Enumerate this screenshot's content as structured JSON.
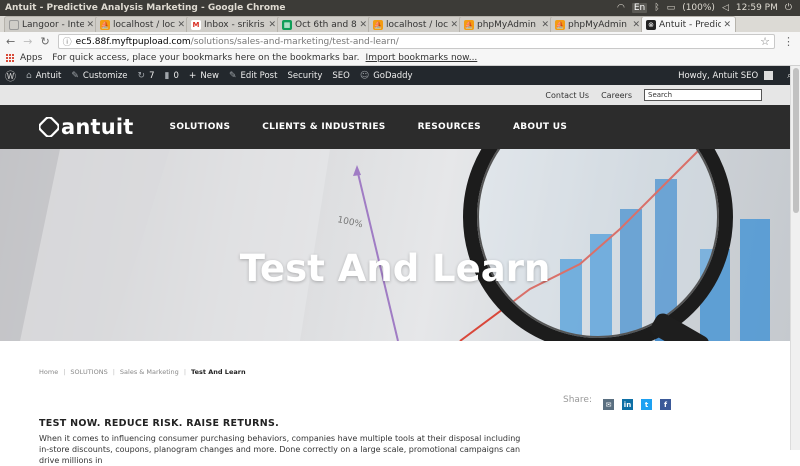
{
  "os": {
    "window_title": "Antuit - Predictive Analysis Marketing - Google Chrome",
    "kbd": "En",
    "battery": "(100%)",
    "time": "12:59 PM"
  },
  "tabs": [
    {
      "label": "Langoor - Inte",
      "fav_color": "#ffffff",
      "fav_char": ""
    },
    {
      "label": "localhost / loc",
      "fav_color": "#f39c12",
      "fav_char": "⛵"
    },
    {
      "label": "Inbox - srikris",
      "fav_color": "#d93025",
      "fav_char": "M"
    },
    {
      "label": "Oct 6th and 8t",
      "fav_color": "#0f9d58",
      "fav_char": "▦"
    },
    {
      "label": "localhost / loc",
      "fav_color": "#f39c12",
      "fav_char": "⛵"
    },
    {
      "label": "phpMyAdmin",
      "fav_color": "#f39c12",
      "fav_char": "⛵"
    },
    {
      "label": "phpMyAdmin",
      "fav_color": "#f39c12",
      "fav_char": "⛵"
    },
    {
      "label": "Antuit - Predic",
      "fav_color": "#222222",
      "fav_char": "⊗",
      "active": true
    }
  ],
  "address": {
    "host": "ec5.88f.myftpupload.com",
    "path": "/solutions/sales-and-marketing/test-and-learn/"
  },
  "bookmarks": {
    "apps": "Apps",
    "hint": "For quick access, place your bookmarks here on the bookmarks bar.",
    "import": "Import bookmarks now..."
  },
  "wpbar": {
    "site": "Antuit",
    "customize": "Customize",
    "updates": "7",
    "comments": "0",
    "new": "New",
    "edit": "Edit Post",
    "security": "Security",
    "seo": "SEO",
    "godaddy": "GoDaddy",
    "howdy": "Howdy, Antuit SEO"
  },
  "util": {
    "contact": "Contact Us",
    "careers": "Careers",
    "search_placeholder": "Search"
  },
  "header": {
    "logo": "antuit",
    "nav": [
      "SOLUTIONS",
      "CLIENTS & INDUSTRIES",
      "RESOURCES",
      "ABOUT US"
    ]
  },
  "hero": {
    "title": "Test And Learn",
    "image_label": "100%"
  },
  "breadcrumb": [
    "Home",
    "SOLUTIONS",
    "Sales & Marketing",
    "Test And Learn"
  ],
  "content": {
    "heading": "TEST NOW. REDUCE RISK. RAISE RETURNS.",
    "body": "When it comes to influencing consumer purchasing behaviors, companies have multiple tools at their disposal including in-store discounts, coupons, planogram changes and more. Done correctly on a large scale, promotional campaigns can drive millions in"
  },
  "share": {
    "label": "Share:",
    "icons": [
      {
        "name": "email",
        "color": "#5a6f80"
      },
      {
        "name": "linkedin",
        "color": "#0e6fa5"
      },
      {
        "name": "twitter",
        "color": "#1da1f2"
      },
      {
        "name": "facebook",
        "color": "#3b5998"
      }
    ]
  }
}
